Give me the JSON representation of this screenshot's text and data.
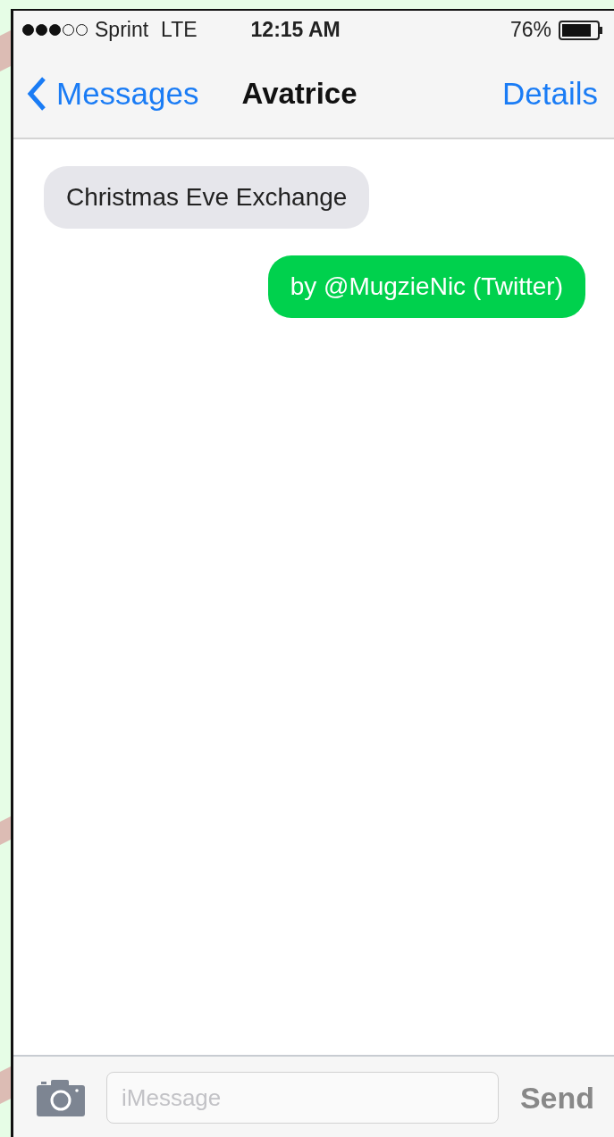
{
  "status_bar": {
    "carrier": "Sprint",
    "network": "LTE",
    "time": "12:15 AM",
    "battery": "76%"
  },
  "nav_bar": {
    "back": "Messages",
    "title": "Avatrice",
    "action": "Details"
  },
  "messages": [
    {
      "kind": "received",
      "text": "Christmas Eve Exchange"
    },
    {
      "kind": "sent",
      "text": "by @MugzieNic (Twitter)"
    }
  ],
  "compose": {
    "placeholder": "iMessage",
    "send": "Send"
  }
}
